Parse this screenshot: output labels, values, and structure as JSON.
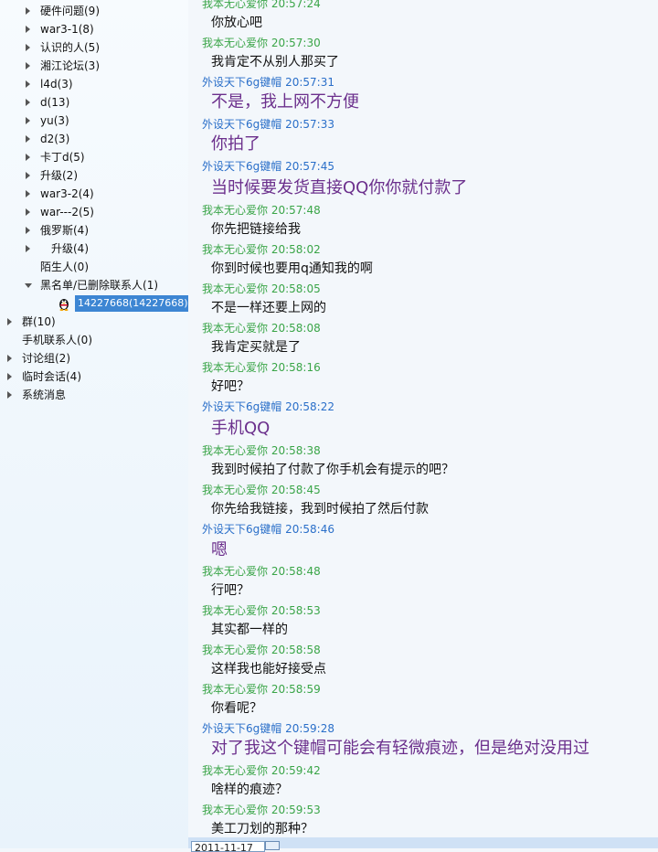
{
  "sidebar": {
    "groups": [
      {
        "label": "硬件问题(9)"
      },
      {
        "label": "war3-1(8)"
      },
      {
        "label": "认识的人(5)"
      },
      {
        "label": "湘江论坛(3)"
      },
      {
        "label": "l4d(3)"
      },
      {
        "label": "d(13)"
      },
      {
        "label": "yu(3)"
      },
      {
        "label": "d2(3)"
      },
      {
        "label": "卡丁d(5)"
      },
      {
        "label": "升级(2)"
      },
      {
        "label": "war3-2(4)"
      },
      {
        "label": "war---2(5)"
      },
      {
        "label": "俄罗斯(4)"
      },
      {
        "label": "升级(4)"
      },
      {
        "label": "陌生人(0)"
      },
      {
        "label": "黑名单/已删除联系人(1)"
      }
    ],
    "selected_contact": "14227668(14227668)",
    "top_sections": [
      {
        "label": "群(10)"
      },
      {
        "label": "手机联系人(0)"
      },
      {
        "label": "讨论组(2)"
      },
      {
        "label": "临时会话(4)"
      },
      {
        "label": "系统消息"
      }
    ]
  },
  "chat": {
    "messages": [
      {
        "sender": "我本无心爱你",
        "time": "20:57:24",
        "text": "你放心吧"
      },
      {
        "sender": "我本无心爱你",
        "time": "20:57:30",
        "text": "我肯定不从别人那买了"
      },
      {
        "sender": "外设天下6g键帽",
        "time": "20:57:31",
        "text": "不是，我上网不方便"
      },
      {
        "sender": "外设天下6g键帽",
        "time": "20:57:33",
        "text": "你拍了"
      },
      {
        "sender": "外设天下6g键帽",
        "time": "20:57:45",
        "text": "当时候要发货直接QQ你你就付款了"
      },
      {
        "sender": "我本无心爱你",
        "time": "20:57:48",
        "text": "你先把链接给我"
      },
      {
        "sender": "我本无心爱你",
        "time": "20:58:02",
        "text": "你到时候也要用q通知我的啊"
      },
      {
        "sender": "我本无心爱你",
        "time": "20:58:05",
        "text": "不是一样还要上网的"
      },
      {
        "sender": "我本无心爱你",
        "time": "20:58:08",
        "text": "我肯定买就是了"
      },
      {
        "sender": "我本无心爱你",
        "time": "20:58:16",
        "text": "好吧？"
      },
      {
        "sender": "外设天下6g键帽",
        "time": "20:58:22",
        "text": "手机QQ"
      },
      {
        "sender": "我本无心爱你",
        "time": "20:58:38",
        "text": "我到时候拍了付款了你手机会有提示的吧？"
      },
      {
        "sender": "我本无心爱你",
        "time": "20:58:45",
        "text": "你先给我链接，我到时候拍了然后付款"
      },
      {
        "sender": "外设天下6g键帽",
        "time": "20:58:46",
        "text": "嗯"
      },
      {
        "sender": "我本无心爱你",
        "time": "20:58:48",
        "text": "行吧？"
      },
      {
        "sender": "我本无心爱你",
        "time": "20:58:53",
        "text": "其实都一样的"
      },
      {
        "sender": "我本无心爱你",
        "time": "20:58:58",
        "text": "这样我也能好接受点"
      },
      {
        "sender": "我本无心爱你",
        "time": "20:58:59",
        "text": "你看呢？"
      },
      {
        "sender": "外设天下6g键帽",
        "time": "20:59:28",
        "text": "对了我这个键帽可能会有轻微痕迹，但是绝对没用过"
      },
      {
        "sender": "我本无心爱你",
        "time": "20:59:42",
        "text": "啥样的痕迹？"
      },
      {
        "sender": "我本无心爱你",
        "time": "20:59:53",
        "text": "美工刀划的那种？"
      }
    ]
  },
  "bottom_bar": {
    "date_value": "2011-11-17",
    "calendar_icon": "calendar-icon"
  },
  "colors": {
    "me": "#3aa548",
    "other": "#2a6fc9",
    "other_text": "#6b2f8c",
    "selected_bg": "#3d86d3"
  }
}
